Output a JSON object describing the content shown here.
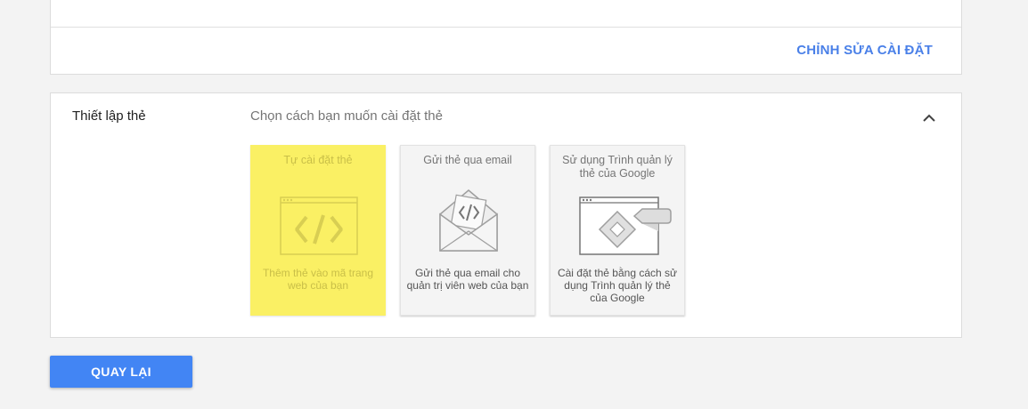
{
  "top_panel": {
    "edit_label": "CHỈNH SỬA CÀI ĐẶT"
  },
  "setup": {
    "title": "Thiết lập thẻ",
    "subtitle": "Chọn cách bạn muốn cài đặt thẻ",
    "collapse_icon": "chevron-up-icon",
    "options": [
      {
        "title": "Tự cài đặt thẻ",
        "description": "Thêm thẻ vào mã trang web của bạn",
        "icon": "code-window-icon",
        "highlighted": true
      },
      {
        "title": "Gửi thẻ qua email",
        "description": "Gửi thẻ qua email cho quản trị viên web của bạn",
        "icon": "email-code-icon",
        "highlighted": false
      },
      {
        "title": "Sử dụng Trình quản lý thẻ của Google",
        "description": "Cài đặt thẻ bằng cách sử dụng Trình quản lý thẻ của Google",
        "icon": "tag-manager-icon",
        "highlighted": false
      }
    ]
  },
  "back_button_label": "QUAY LẠI",
  "colors": {
    "accent": "#4285f4",
    "link": "#4a80e8",
    "highlight": "#faf064"
  }
}
